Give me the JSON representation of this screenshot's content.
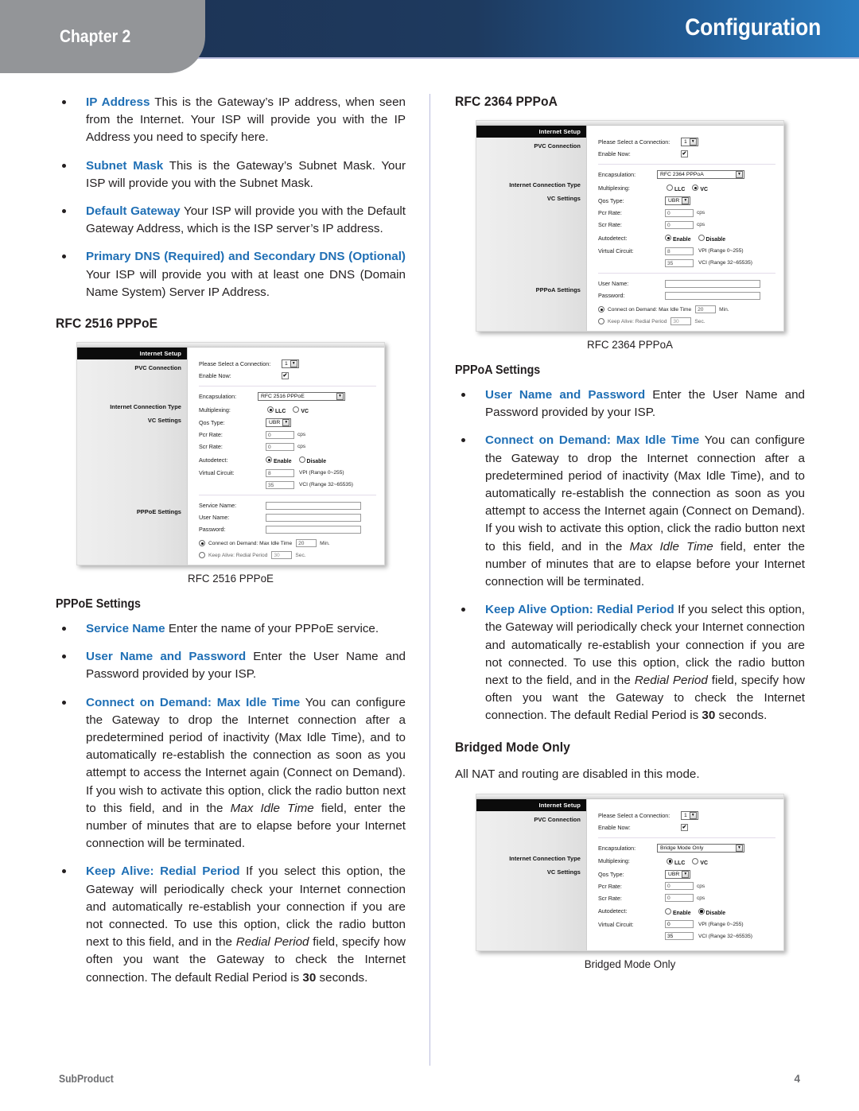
{
  "header": {
    "chapter_label": "Chapter 2",
    "title": "Configuration",
    "accent_dark": "#1e3a5f",
    "accent_light": "#2a7cc0",
    "tab_gray": "#939598"
  },
  "footer": {
    "product": "SubProduct",
    "page_number": "4"
  },
  "colors": {
    "term_blue": "#1f6fb5",
    "body_text": "#231f20",
    "divider": "#b9bcdd"
  },
  "left_column": {
    "bullets": [
      {
        "term": "IP Address",
        "text": " This is the Gateway’s IP address, when seen from the Internet. Your ISP will provide you with the IP Address you need to specify here."
      },
      {
        "term": "Subnet Mask",
        "text": "  This is the Gateway’s Subnet Mask. Your ISP will provide you with the Subnet Mask."
      },
      {
        "term": "Default Gateway",
        "text": "  Your ISP will provide you with the Default Gateway Address, which is the ISP server’s IP address."
      },
      {
        "term": "Primary DNS (Required) and Secondary DNS (Optional)",
        "text": "  Your ISP will provide you with at least one DNS (Domain Name System) Server IP Address."
      }
    ],
    "section_head": "RFC 2516 PPPoE",
    "figure_caption": "RFC 2516 PPPoE",
    "sub_head": "PPPoE Settings",
    "settings_bullets": [
      {
        "term": "Service Name",
        "text": "  Enter the name of your PPPoE service."
      },
      {
        "term": "User Name and Password",
        "text": "  Enter the User Name and Password provided by your ISP."
      },
      {
        "term": "Connect on Demand: Max Idle Time",
        "text_part1": " You can configure the Gateway to drop the Internet connection after a predetermined period of inactivity (Max Idle Time), and to automatically re-establish the connection as soon as you attempt to access the Internet again (Connect on Demand). If you wish to activate this option, click the radio button next to this field, and in the ",
        "italic1": "Max Idle Time",
        "text_part2": " field, enter the number of minutes that are to elapse before your Internet connection will be terminated."
      },
      {
        "term": "Keep Alive: Redial Period",
        "text_part1": "  If you select this option, the Gateway will periodically check your Internet connection and automatically re-establish your connection if you are not connected. To use this option, click the radio button next to this field, and in the ",
        "italic1": "Redial Period",
        "text_part2": " field, specify how often you want the Gateway to check the Internet connection. The default Redial Period is ",
        "bold1": "30",
        "text_part3": " seconds."
      }
    ]
  },
  "right_column": {
    "section_head": "RFC 2364 PPPoA",
    "figure_caption": "RFC 2364 PPPoA",
    "sub_head": "PPPoA Settings",
    "settings_bullets": [
      {
        "term": "User Name and Password",
        "text": "  Enter the User Name and Password provided by your ISP."
      },
      {
        "term": "Connect on Demand: Max Idle Time",
        "text_part1": " You can configure the Gateway to drop the Internet connection after a predetermined period of inactivity (Max Idle Time), and to automatically re-establish the connection as soon as you attempt to access the Internet again (Connect on Demand). If you wish to activate this option, click the radio button next to this field, and in the ",
        "italic1": "Max Idle Time",
        "text_part2": " field, enter the number of minutes that are to elapse before your Internet connection will be terminated."
      },
      {
        "term": "Keep Alive Option: Redial Period",
        "text_part1": "  If you select this option, the Gateway will periodically check your Internet connection and automatically re-establish your connection if you are not connected. To use this option, click the radio button next to the field, and in the ",
        "italic1": "Redial Period",
        "text_part2": " field, specify how often you want the Gateway to check the Internet connection. The default Redial Period is ",
        "bold1": "30",
        "text_part3": " seconds."
      }
    ],
    "bridged_head": "Bridged Mode Only",
    "bridged_para": "All NAT and routing are disabled in this mode.",
    "bridged_figure_caption": "Bridged Mode Only"
  },
  "screenshots": {
    "pppoe": {
      "banner": "Internet Setup",
      "side_labels": {
        "pvc": "PVC Connection",
        "ict": "Internet Connection Type",
        "vc": "VC Settings",
        "settings": "PPPoE Settings"
      },
      "rows": {
        "select_connection_label": "Please Select a Connection:",
        "select_connection_value": "1",
        "enable_now_label": "Enable Now:",
        "enable_now_checked": "✔",
        "encapsulation_label": "Encapsulation:",
        "encapsulation_value": "RFC 2516 PPPoE",
        "multiplexing_label": "Multiplexing:",
        "multiplexing_llc": "LLC",
        "multiplexing_vc": "VC",
        "multiplexing_selected": "LLC",
        "qos_label": "Qos Type:",
        "qos_value": "UBR",
        "pcr_label": "Pcr Rate:",
        "pcr_value": "0",
        "pcr_unit": "cps",
        "scr_label": "Scr Rate:",
        "scr_value": "0",
        "scr_unit": "cps",
        "autodetect_label": "Autodetect:",
        "autodetect_enable": "Enable",
        "autodetect_disable": "Disable",
        "autodetect_selected": "Enable",
        "vcirc_label": "Virtual Circuit:",
        "vpi_value": "8",
        "vpi_note": "VPI (Range 0~255)",
        "vci_value": "35",
        "vci_note": "VCI (Range 32~65535)",
        "service_name_label": "Service Name:",
        "service_name_value": "",
        "user_name_label": "User Name:",
        "user_name_value": "",
        "password_label": "Password:",
        "password_value": "",
        "cod_label": "Connect on Demand: Max Idle Time",
        "cod_value": "20",
        "cod_unit": "Min.",
        "ka_label": "Keep Alive: Redial Period",
        "ka_value": "30",
        "ka_unit": "Sec.",
        "mode_selected": "Connect on Demand"
      }
    },
    "pppoa": {
      "banner": "Internet Setup",
      "side_labels": {
        "pvc": "PVC Connection",
        "ict": "Internet Connection Type",
        "vc": "VC Settings",
        "settings": "PPPoA Settings"
      },
      "rows": {
        "select_connection_label": "Please Select a Connection:",
        "select_connection_value": "1",
        "enable_now_label": "Enable Now:",
        "enable_now_checked": "✔",
        "encapsulation_label": "Encapsulation:",
        "encapsulation_value": "RFC 2364 PPPoA",
        "multiplexing_label": "Multiplexing:",
        "multiplexing_llc": "LLC",
        "multiplexing_vc": "VC",
        "multiplexing_selected": "VC",
        "qos_label": "Qos Type:",
        "qos_value": "UBR",
        "pcr_label": "Pcr Rate:",
        "pcr_value": "0",
        "pcr_unit": "cps",
        "scr_label": "Scr Rate:",
        "scr_value": "0",
        "scr_unit": "cps",
        "autodetect_label": "Autodetect:",
        "autodetect_enable": "Enable",
        "autodetect_disable": "Disable",
        "autodetect_selected": "Enable",
        "vcirc_label": "Virtual Circuit:",
        "vpi_value": "8",
        "vpi_note": "VPI (Range 0~255)",
        "vci_value": "35",
        "vci_note": "VCI (Range 32~65535)",
        "user_name_label": "User Name:",
        "user_name_value": "",
        "password_label": "Password:",
        "password_value": "",
        "cod_label": "Connect on Demand: Max Idle Time",
        "cod_value": "20",
        "cod_unit": "Min.",
        "ka_label": "Keep Alive: Redial Period",
        "ka_value": "30",
        "ka_unit": "Sec.",
        "mode_selected": "Connect on Demand"
      }
    },
    "bridge": {
      "banner": "Internet Setup",
      "side_labels": {
        "pvc": "PVC Connection",
        "ict": "Internet Connection Type",
        "vc": "VC Settings"
      },
      "rows": {
        "select_connection_label": "Please Select a Connection:",
        "select_connection_value": "1",
        "enable_now_label": "Enable Now:",
        "enable_now_checked": "✔",
        "encapsulation_label": "Encapsulation:",
        "encapsulation_value": "Bridge Mode Only",
        "multiplexing_label": "Multiplexing:",
        "multiplexing_llc": "LLC",
        "multiplexing_vc": "VC",
        "multiplexing_selected": "LLC",
        "qos_label": "Qos Type:",
        "qos_value": "UBR",
        "pcr_label": "Pcr Rate:",
        "pcr_value": "0",
        "pcr_unit": "cps",
        "scr_label": "Scr Rate:",
        "scr_value": "0",
        "scr_unit": "cps",
        "autodetect_label": "Autodetect:",
        "autodetect_enable": "Enable",
        "autodetect_disable": "Disable",
        "autodetect_selected": "Disable",
        "vcirc_label": "Virtual Circuit:",
        "vpi_value": "0",
        "vpi_note": "VPI (Range 0~255)",
        "vci_value": "35",
        "vci_note": "VCI (Range 32~65535)"
      }
    }
  }
}
